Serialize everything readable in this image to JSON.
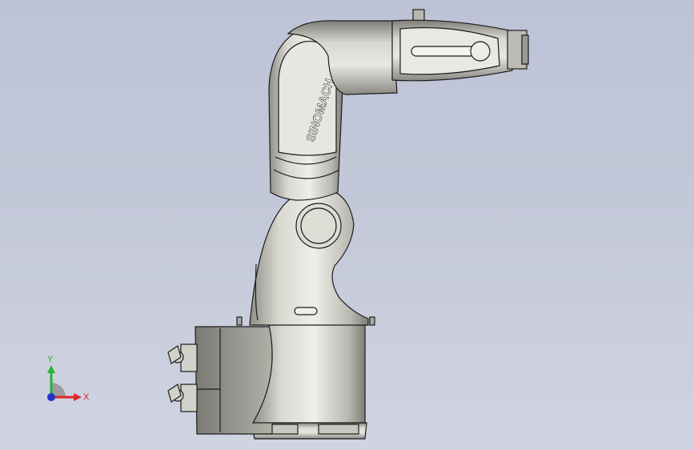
{
  "viewport": {
    "background_top": "#bdc3d6",
    "background_bottom": "#d0d4e1"
  },
  "model": {
    "brand_text": "SINOMACH",
    "body_color": "#d7d6cf",
    "shadow_color": "#8e8d86",
    "outline_color": "#1c1c1c"
  },
  "triad": {
    "x_label": "X",
    "y_label": "Y",
    "x_color": "#e0262a",
    "y_color": "#27b23a",
    "z_color": "#2233cc"
  }
}
